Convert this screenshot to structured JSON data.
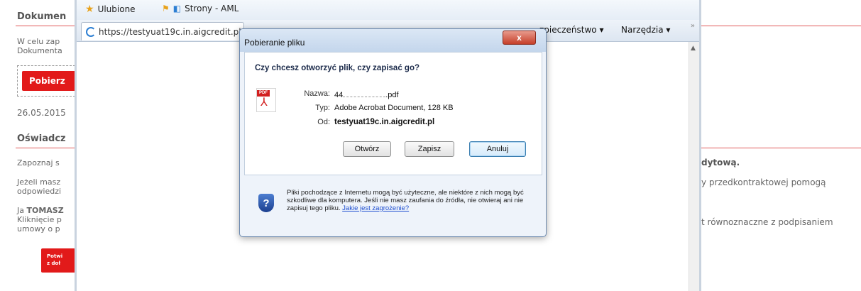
{
  "background_left": {
    "heading_1": "Dokumen",
    "text_1a": "W celu zap",
    "text_1b": "Dokumenta",
    "download_button": "Pobierz",
    "date": "26.05.2015",
    "heading_2": "Oświadcz",
    "text_2a": "Zapoznaj s",
    "text_3a": "Jeżeli masz",
    "text_3b": "odpowiedzi",
    "text_4a_prefix": "Ja ",
    "text_4a_name": "TOMASZ",
    "text_4b": "Kliknięcie p",
    "text_4c": "umowy o p",
    "confirm_button_line1": "Potwi",
    "confirm_button_line2": "z doł"
  },
  "background_right": {
    "text_1": "dytową.",
    "text_2": "y przedkontraktowej pomogą",
    "text_3": "t równoznaczne z podpisaniem"
  },
  "browser": {
    "favorites_label": "Ulubione",
    "pages_label": "Strony - AML",
    "tab_url": "https://testyuat19c.in.aigcredit.pl",
    "security_menu": "zpieczeństwo ▾",
    "tools_menu": "Narzędzia ▾",
    "chevron": "»"
  },
  "dialog": {
    "title": "Pobieranie pliku",
    "close_label": "x",
    "question": "Czy chcesz otworzyć plik, czy zapisać go?",
    "icon_tag": "PDF",
    "name_label": "Nazwa:",
    "name_value_prefix": "44",
    "name_value_suffix": ".pdf",
    "type_label": "Typ:",
    "type_value": "Adobe Acrobat Document, 128 KB",
    "from_label": "Od:",
    "from_value": "testyuat19c.in.aigcredit.pl",
    "open_button": "Otwórz",
    "save_button": "Zapisz",
    "cancel_button": "Anuluj",
    "warning_text": "Pliki pochodzące z Internetu mogą być użyteczne, ale niektóre z nich mogą być szkodliwe dla komputera. Jeśli nie masz zaufania do źródła, nie otwieraj ani nie zapisuj tego pliku. ",
    "warning_link": "Jakie jest zagrożenie?"
  }
}
